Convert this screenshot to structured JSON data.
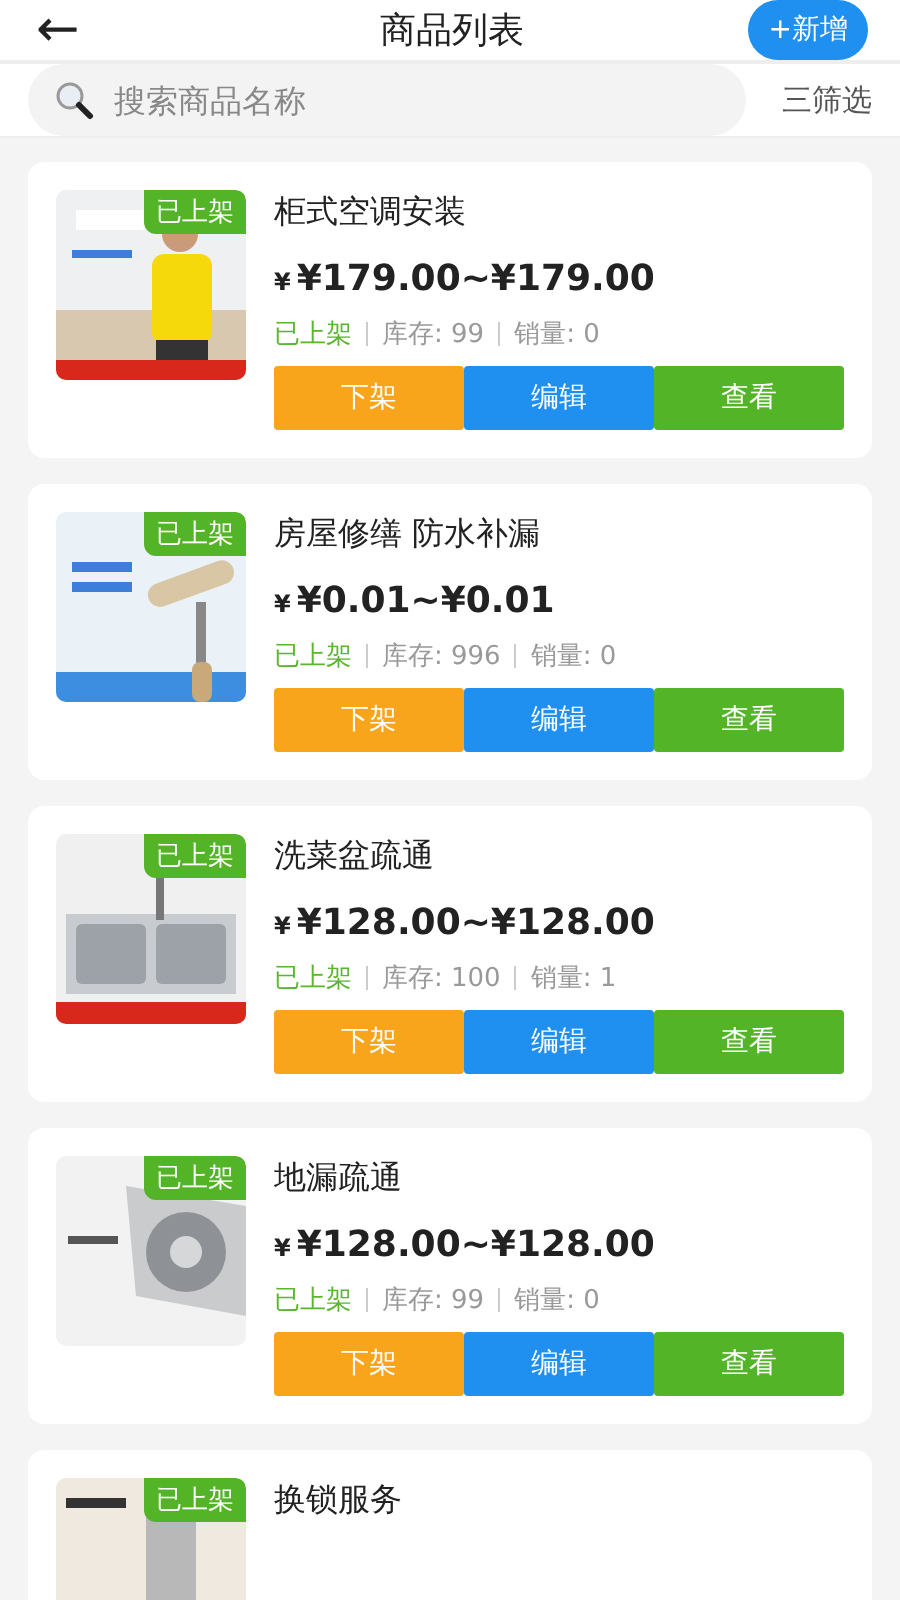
{
  "header": {
    "back": "←",
    "title": "商品列表",
    "add_button": "+新增"
  },
  "search": {
    "placeholder": "搜索商品名称",
    "filter": "三筛选"
  },
  "products": [
    {
      "title": "柜式空调安装",
      "badge": "已上架",
      "currency": "¥",
      "price": "¥179.00~¥179.00",
      "status": "已上架",
      "stock": "库存: 99",
      "sales": "销量: 0",
      "buttons": [
        {
          "kind": "unlist",
          "label": "下架"
        },
        {
          "kind": "edit",
          "label": "编辑"
        },
        {
          "kind": "view",
          "label": "查看"
        }
      ]
    },
    {
      "title": "房屋修缮 防水补漏",
      "badge": "已上架",
      "currency": "¥",
      "price": "¥0.01~¥0.01",
      "status": "已上架",
      "stock": "库存: 996",
      "sales": "销量: 0",
      "buttons": [
        {
          "kind": "unlist",
          "label": "下架"
        },
        {
          "kind": "edit",
          "label": "编辑"
        },
        {
          "kind": "view",
          "label": "查看"
        }
      ]
    },
    {
      "title": "洗菜盆疏通",
      "badge": "已上架",
      "currency": "¥",
      "price": "¥128.00~¥128.00",
      "status": "已上架",
      "stock": "库存: 100",
      "sales": "销量: 1",
      "buttons": [
        {
          "kind": "unlist",
          "label": "下架"
        },
        {
          "kind": "edit",
          "label": "编辑"
        },
        {
          "kind": "view",
          "label": "查看"
        }
      ]
    },
    {
      "title": "地漏疏通",
      "badge": "已上架",
      "currency": "¥",
      "price": "¥128.00~¥128.00",
      "status": "已上架",
      "stock": "库存: 99",
      "sales": "销量: 0",
      "buttons": [
        {
          "kind": "unlist",
          "label": "下架"
        },
        {
          "kind": "edit",
          "label": "编辑"
        },
        {
          "kind": "view",
          "label": "查看"
        }
      ]
    },
    {
      "title": "换锁服务",
      "badge": "已上架"
    }
  ]
}
